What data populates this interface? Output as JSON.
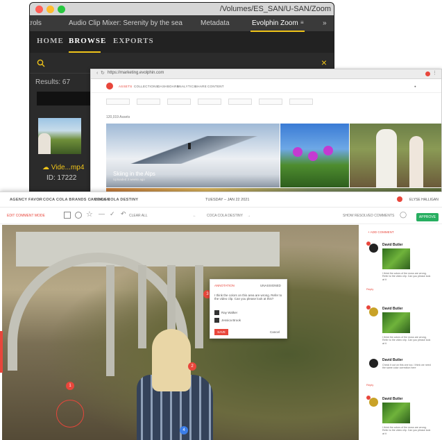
{
  "window1": {
    "path": "/Volumes/ES_SAN/U-SAN/Zoom",
    "tabs": [
      "trols",
      "Audio Clip Mixer: Serenity by the sea",
      "Metadata",
      "Evolphin Zoom"
    ],
    "nav": [
      "HOME",
      "BROWSE",
      "EXPORTS"
    ],
    "results": "Results: 67",
    "clip_name": "Vide...mp4",
    "clip_id": "ID: 17222",
    "colors": {
      "accent": "#f0c419"
    }
  },
  "window2": {
    "url": "https://marketing.evolphin.com",
    "menu": [
      "ASSETS",
      "COLLECTIONS",
      "DASHBOARD",
      "ANALYTICS",
      "SHARE",
      "CONTENT"
    ],
    "filters": [
      "Filter",
      "Product Type",
      "Tags",
      "Auteur",
      "Date",
      "Color",
      "Access"
    ],
    "asset_count": "120,019 Assets",
    "hero_caption": "Skiing in the Alps",
    "hero_sub": "Uploaded 3 weeks ago",
    "colors": {
      "brand": "#e8463b"
    }
  },
  "window3": {
    "breadcrumbs": [
      "AGENCY FAVOR",
      "COCA COLA BRANDS CAMPAIGN",
      "COCA COLA DESTINY"
    ],
    "date": "TUESDAY – JAN 22 2021",
    "user": "ELYSE HALLIGAN",
    "toolbar": {
      "edit": "EDIT COMMENT MODE",
      "clear": "CLEAR ALL",
      "asset": "COCA COLA DESTINY",
      "show": "SHOW RESOLVED COMMENTS",
      "approve": "APPROVE"
    },
    "popup": {
      "author": "ANNOTATION",
      "status": "UNASSIGNED",
      "body": "I think the colors on this area are wrong. Refer to the video clip. Can you please look at this?",
      "people": [
        "Ray Walker",
        "Jessica Brook"
      ],
      "save": "SAVE",
      "cancel": "Cancel"
    },
    "add_comment": "+ ADD COMMENT",
    "comments": [
      {
        "name": "David Butler",
        "text": "I think the colors of the moss are wrong. Refer to the video clip. Can you please look at it",
        "reply": "Reply"
      },
      {
        "name": "David Butler",
        "text": "I think the colors of the moss are wrong. Refer to the video clip. Can you please look at it",
        "reply": "Reply"
      },
      {
        "name": "David Butler",
        "text": "Check it out on this one too. I think we need the same color correction here",
        "reply": "Reply"
      },
      {
        "name": "David Butler",
        "text": "I think the colors of the moss are wrong. Refer to the video clip. Can you please look at it",
        "reply": "Reply"
      }
    ],
    "colors": {
      "accent": "#e8463b",
      "approve": "#27ae60"
    }
  }
}
